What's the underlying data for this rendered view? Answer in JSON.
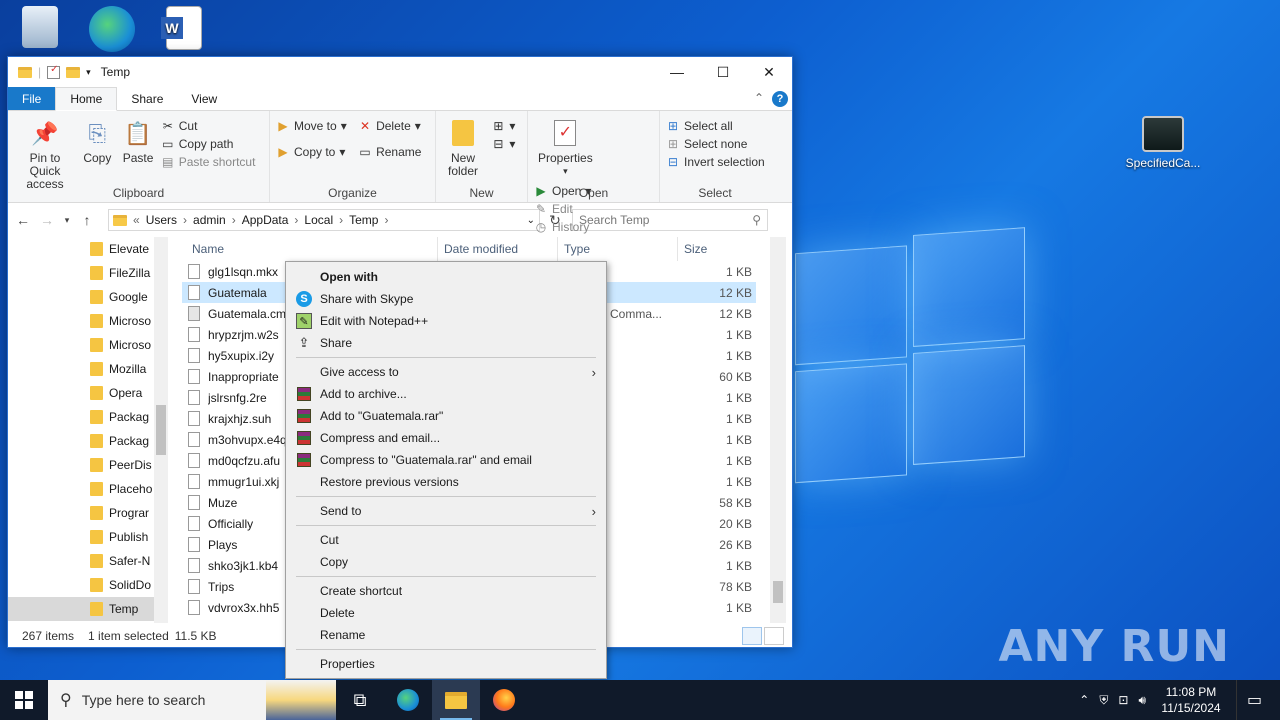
{
  "desktop": {
    "icons": [
      {
        "label": "",
        "name": "recycle-bin"
      },
      {
        "label": "",
        "name": "edge"
      },
      {
        "label": "",
        "name": "word"
      },
      {
        "label": "SpecifiedCa...",
        "name": "specifiedca"
      }
    ],
    "watermark": "ANY RUN"
  },
  "window": {
    "title": "Temp",
    "controls": {
      "minimize": "—",
      "maximize": "☐",
      "close": "✕"
    },
    "tabs": [
      "File",
      "Home",
      "Share",
      "View"
    ],
    "active_tab": "Home",
    "ribbon": {
      "clipboard": {
        "name": "Clipboard",
        "pin": "Pin to Quick access",
        "copy": "Copy",
        "paste": "Paste",
        "cut": "Cut",
        "copy_path": "Copy path",
        "paste_shortcut": "Paste shortcut"
      },
      "organize": {
        "name": "Organize",
        "move_to": "Move to",
        "copy_to": "Copy to",
        "delete": "Delete",
        "rename": "Rename"
      },
      "new": {
        "name": "New",
        "new_folder": "New folder"
      },
      "open": {
        "name": "Open",
        "properties": "Properties",
        "open": "Open",
        "edit": "Edit",
        "history": "History"
      },
      "select": {
        "name": "Select",
        "select_all": "Select all",
        "select_none": "Select none",
        "invert": "Invert selection"
      }
    },
    "address": {
      "prefix": "«",
      "crumbs": [
        "Users",
        "admin",
        "AppData",
        "Local",
        "Temp"
      ],
      "search_placeholder": "Search Temp"
    },
    "nav_items": [
      "Elevate",
      "FileZilla",
      "Google",
      "Microso",
      "Microso",
      "Mozilla",
      "Opera",
      "Packag",
      "Packag",
      "PeerDis",
      "Placeho",
      "Prograr",
      "Publish",
      "Safer-N",
      "SolidDo",
      "Temp"
    ],
    "columns": {
      "name": "Name",
      "date": "Date modified",
      "type": "Type",
      "size": "Size"
    },
    "files": [
      {
        "name": "glg1lsqn.mkx",
        "type": "e",
        "size": "1 KB"
      },
      {
        "name": "Guatemala",
        "type": "",
        "size": "12 KB"
      },
      {
        "name": "Guatemala.cmd",
        "type": "ws Comma...",
        "size": "12 KB"
      },
      {
        "name": "hrypzrjm.w2s",
        "type": "e",
        "size": "1 KB"
      },
      {
        "name": "hy5xupix.i2y",
        "type": "",
        "size": "1 KB"
      },
      {
        "name": "Inappropriate",
        "type": "",
        "size": "60 KB"
      },
      {
        "name": "jslrsnfg.2re",
        "type": "",
        "size": "1 KB"
      },
      {
        "name": "krajxhjz.suh",
        "type": "e",
        "size": "1 KB"
      },
      {
        "name": "m3ohvupx.e4q",
        "type": "",
        "size": "1 KB"
      },
      {
        "name": "md0qcfzu.afu",
        "type": "e",
        "size": "1 KB"
      },
      {
        "name": "mmugr1ui.xkj",
        "type": "",
        "size": "1 KB"
      },
      {
        "name": "Muze",
        "type": "",
        "size": "58 KB"
      },
      {
        "name": "Officially",
        "type": "",
        "size": "20 KB"
      },
      {
        "name": "Plays",
        "type": "",
        "size": "26 KB"
      },
      {
        "name": "shko3jk1.kb4",
        "type": "",
        "size": "1 KB"
      },
      {
        "name": "Trips",
        "type": "",
        "size": "78 KB"
      },
      {
        "name": "vdvrox3x.hh5",
        "type": "e",
        "size": "1 KB"
      }
    ],
    "status": {
      "count": "267 items",
      "selected": "1 item selected",
      "size": "11.5 KB"
    }
  },
  "context_menu": {
    "groups": [
      [
        {
          "label": "Open with",
          "bold": true,
          "icon": ""
        },
        {
          "label": "Share with Skype",
          "icon": "skype-icon"
        },
        {
          "label": "Edit with Notepad++",
          "icon": "notepadpp-icon"
        },
        {
          "label": "Share",
          "icon": "share-icon"
        }
      ],
      [
        {
          "label": "Give access to",
          "submenu": true
        },
        {
          "label": "Add to archive...",
          "icon": "winrar-icon"
        },
        {
          "label": "Add to \"Guatemala.rar\"",
          "icon": "winrar-icon"
        },
        {
          "label": "Compress and email...",
          "icon": "winrar-icon"
        },
        {
          "label": "Compress to \"Guatemala.rar\" and email",
          "icon": "winrar-icon"
        },
        {
          "label": "Restore previous versions"
        }
      ],
      [
        {
          "label": "Send to",
          "submenu": true
        }
      ],
      [
        {
          "label": "Cut"
        },
        {
          "label": "Copy"
        }
      ],
      [
        {
          "label": "Create shortcut"
        },
        {
          "label": "Delete"
        },
        {
          "label": "Rename"
        }
      ],
      [
        {
          "label": "Properties"
        }
      ]
    ]
  },
  "taskbar": {
    "search_placeholder": "Type here to search",
    "time": "11:08 PM",
    "date": "11/15/2024"
  }
}
